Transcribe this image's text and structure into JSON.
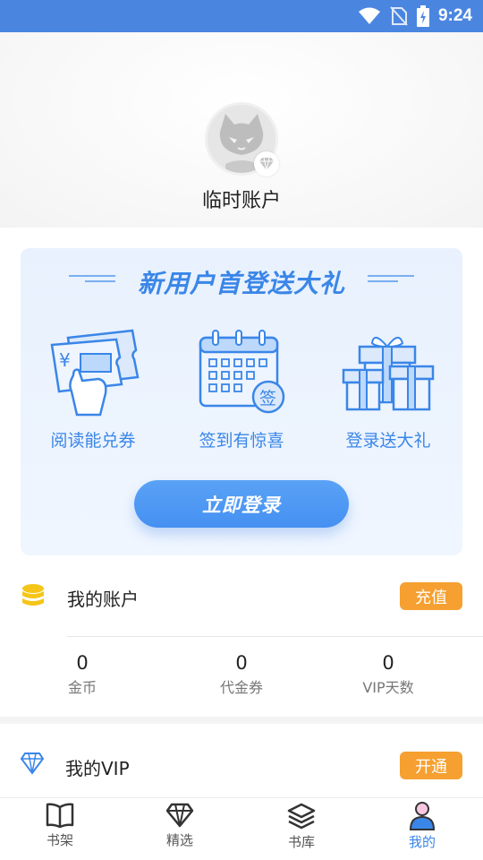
{
  "status_bar": {
    "time": "9:24"
  },
  "profile": {
    "username": "临时账户"
  },
  "promo": {
    "title": "新用户首登送大礼",
    "features": [
      {
        "label": "阅读能兑券",
        "icon": "ticket-icon"
      },
      {
        "label": "签到有惊喜",
        "icon": "calendar-icon"
      },
      {
        "label": "登录送大礼",
        "icon": "gift-icon"
      }
    ],
    "calendar_badge": "签",
    "login_button": "立即登录"
  },
  "account": {
    "title": "我的账户",
    "recharge_button": "充值",
    "stats": [
      {
        "value": "0",
        "label": "金币"
      },
      {
        "value": "0",
        "label": "代金券"
      },
      {
        "value": "0",
        "label": "VIP天数"
      }
    ]
  },
  "vip": {
    "title": "我的VIP",
    "open_button": "开通"
  },
  "tabs": [
    {
      "label": "书架",
      "icon": "book-icon"
    },
    {
      "label": "精选",
      "icon": "diamond-icon"
    },
    {
      "label": "书库",
      "icon": "layers-icon"
    },
    {
      "label": "我的",
      "icon": "person-icon",
      "active": true
    }
  ],
  "colors": {
    "status_bar": "#4a86e0",
    "accent": "#3a86e8",
    "pill": "#f5a031"
  }
}
